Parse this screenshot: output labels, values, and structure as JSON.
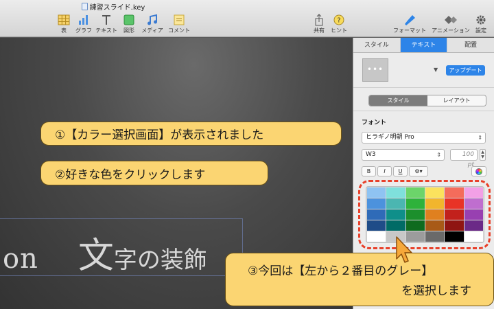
{
  "window": {
    "title": "練習スライド.key"
  },
  "toolbar": {
    "left": [
      {
        "id": "table",
        "label": "表",
        "icon": "table-icon"
      },
      {
        "id": "chart",
        "label": "グラフ",
        "icon": "chart-icon"
      },
      {
        "id": "text",
        "label": "テキスト",
        "icon": "text-icon"
      },
      {
        "id": "shape",
        "label": "図形",
        "icon": "shape-icon"
      },
      {
        "id": "media",
        "label": "メディア",
        "icon": "media-icon"
      },
      {
        "id": "comment",
        "label": "コメント",
        "icon": "comment-icon"
      }
    ],
    "middle": [
      {
        "id": "share",
        "label": "共有",
        "icon": "share-icon"
      },
      {
        "id": "tips",
        "label": "ヒント",
        "icon": "help-icon"
      }
    ],
    "right": [
      {
        "id": "format",
        "label": "フォーマット",
        "icon": "paintbrush-icon"
      },
      {
        "id": "animate",
        "label": "アニメーション",
        "icon": "animate-icon"
      },
      {
        "id": "setup",
        "label": "設定",
        "icon": "gear-icon"
      }
    ]
  },
  "canvas": {
    "text_part1": "on",
    "text_big": "文",
    "text_rest": "字の装飾"
  },
  "annotations": {
    "step1": "①【カラー選択画面】が表示されました",
    "step2": "②好きな色をクリックします",
    "step3_line1": "③今回は【左から２番目のグレー】",
    "step3_line2": "を選択します"
  },
  "inspector": {
    "tabs": [
      "スタイル",
      "テキスト",
      "配置"
    ],
    "active_tab": "テキスト",
    "thumb_text": "•••",
    "update_button": "アップデート",
    "segments": [
      "スタイル",
      "レイアウト"
    ],
    "font_heading": "フォント",
    "font_family": "ヒラギノ明朝 Pro",
    "font_weight": "W3",
    "font_size": "100 pt",
    "format_buttons": [
      "B",
      "I",
      "U",
      "⚙▾"
    ]
  },
  "palette": {
    "rows": [
      [
        "#8fc3f2",
        "#7fe0dc",
        "#6cd46a",
        "#fbe25d",
        "#f46c5b",
        "#f2a0e6"
      ],
      [
        "#4c92dd",
        "#4bb6b1",
        "#2eb23b",
        "#f1b52d",
        "#e83326",
        "#bf6ecf"
      ],
      [
        "#2f6bb8",
        "#0f8f8a",
        "#1c8f2c",
        "#e0801f",
        "#c2211c",
        "#9840b1"
      ],
      [
        "#1f4c88",
        "#006b66",
        "#0f6b1f",
        "#a85a17",
        "#8f1512",
        "#6b2a87"
      ],
      [
        "#ffffff",
        "#c8c8c8",
        "#9c9c9c",
        "#6a6a6a",
        "#000000",
        "#ffffff"
      ]
    ],
    "selected": "#c8c8c8"
  },
  "colors": {
    "accent": "#2d84e8",
    "bubble": "#fbd572",
    "ring": "#e8402a",
    "pointer": "#f6a83a"
  }
}
